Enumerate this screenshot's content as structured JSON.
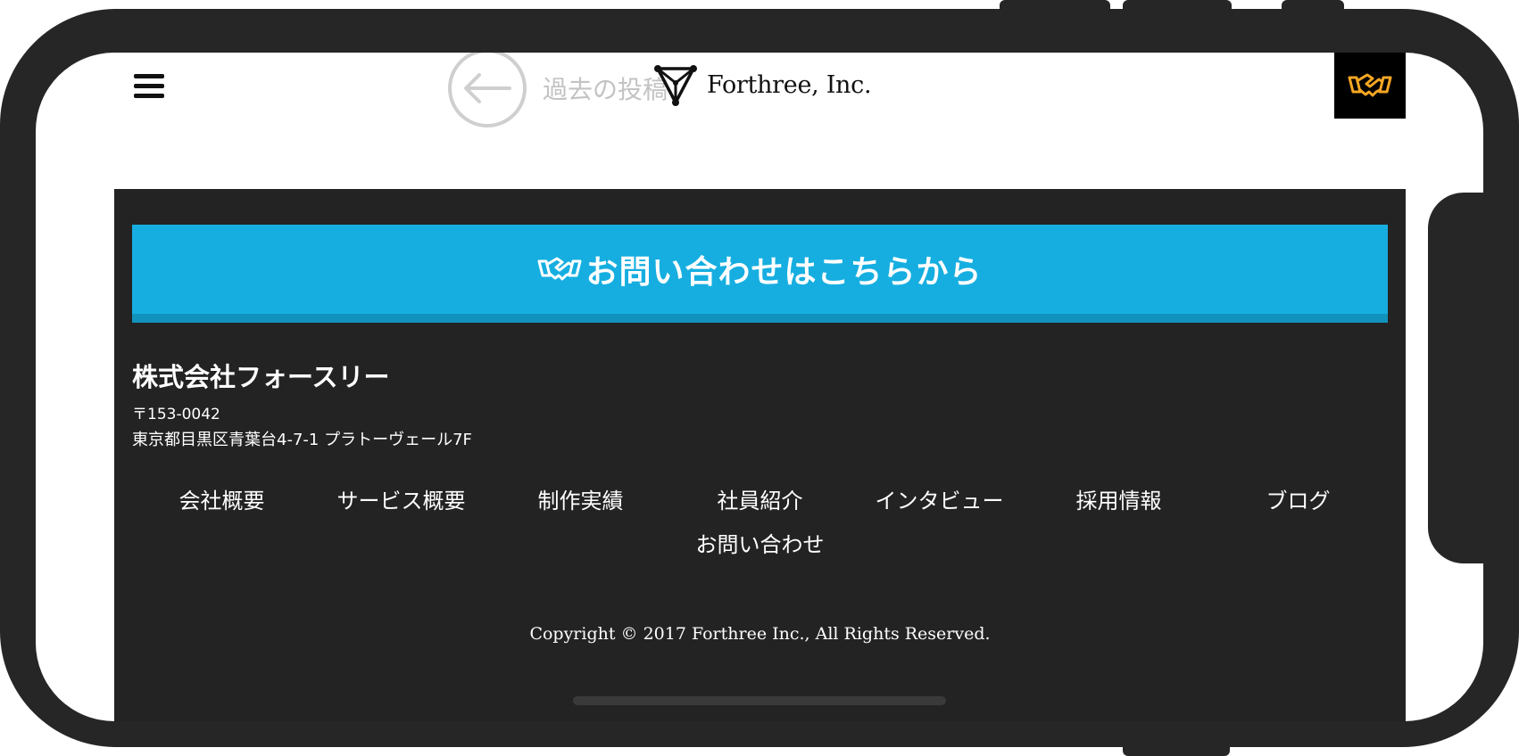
{
  "header": {
    "prev_post_label": "過去の投稿",
    "logo_text": "Forthree, Inc."
  },
  "footer": {
    "cta_label": "お問い合わせはこちらから",
    "company_name": "株式会社フォースリー",
    "postal_code": "〒153-0042",
    "address": "東京都目黒区青葉台4-7-1 プラトーヴェール7F",
    "nav": [
      "会社概要",
      "サービス概要",
      "制作実績",
      "社員紹介",
      "インタビュー",
      "採用情報",
      "ブログ",
      "お問い合わせ"
    ],
    "copyright": "Copyright © 2017 Forthree Inc., All Rights Reserved."
  },
  "icons": {
    "menu": "hamburger-menu-icon",
    "prev": "arrow-left-icon",
    "logo": "forthree-logo-icon",
    "contact": "handshake-icon"
  },
  "colors": {
    "cta_bg": "#16aee0",
    "cta_shadow": "#1192bd",
    "footer_bg": "#232323",
    "handshake_accent": "#f5a623",
    "frame": "#262626"
  }
}
